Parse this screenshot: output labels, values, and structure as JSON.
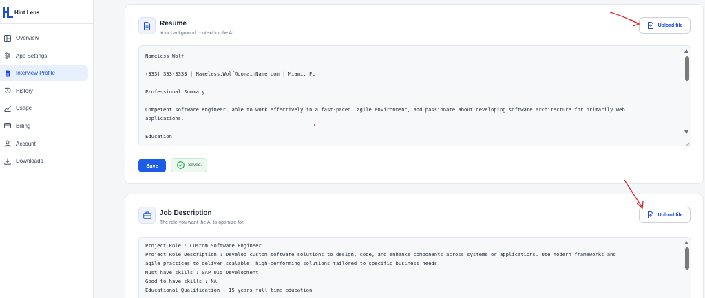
{
  "app": {
    "name": "Hint Lens"
  },
  "sidebar": {
    "items": [
      {
        "label": "Overview",
        "icon": "layout-icon"
      },
      {
        "label": "App Settings",
        "icon": "settings-sliders-icon"
      },
      {
        "label": "Interview Profile",
        "icon": "document-icon",
        "active": true
      },
      {
        "label": "History",
        "icon": "history-icon"
      },
      {
        "label": "Usage",
        "icon": "chart-icon"
      },
      {
        "label": "Billing",
        "icon": "credit-card-icon"
      },
      {
        "label": "Account",
        "icon": "user-icon"
      },
      {
        "label": "Downloads",
        "icon": "download-icon"
      }
    ]
  },
  "resume": {
    "title": "Resume",
    "subtitle": "Your background context for the AI.",
    "upload_label": "Upload file",
    "lines": [
      "Nameless Wolf",
      "(333) 333-3333 | Nameless.Wolf@domainName.com | Miami, FL",
      "Professional Summary",
      "Competent software engineer, able to work effectively in a fast-paced, agile environment, and passionate about developing software architecture for primarily web",
      "applications.",
      "Education"
    ],
    "save_label": "Save",
    "saved_label": "Saved."
  },
  "job_description": {
    "title": "Job Description",
    "subtitle": "The role you want the AI to optimize for.",
    "upload_label": "Upload file",
    "lines": [
      "Project Role : Custom Software Engineer",
      "Project Role Description : Develop custom software solutions to design, code, and enhance components across systems or applications. Use modern frameworks and",
      "agile practices to deliver scalable, high-performing solutions tailored to specific business needs.",
      "Must have skills : SAP UI5 Development",
      "Good to have skills : NA",
      "Educational Qualification : 15 years full time education"
    ]
  },
  "colors": {
    "accent": "#1d5ce6",
    "annotation": "#e02020",
    "active_bg": "#e8f0fd",
    "saved_green": "#16a34a"
  }
}
